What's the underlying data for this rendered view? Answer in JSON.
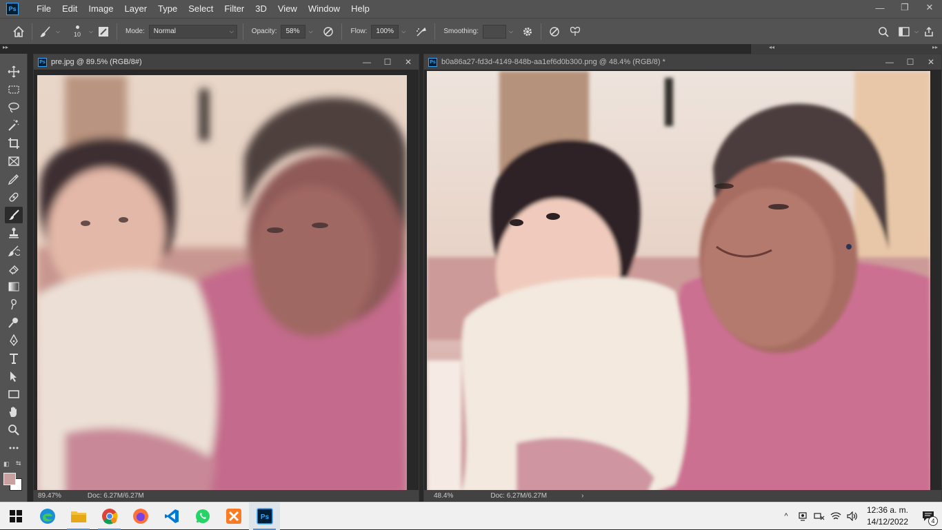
{
  "app": {
    "logo": "Ps"
  },
  "menu": [
    "File",
    "Edit",
    "Image",
    "Layer",
    "Type",
    "Select",
    "Filter",
    "3D",
    "View",
    "Window",
    "Help"
  ],
  "window_controls": {
    "minimize": "—",
    "restore": "❐",
    "close": "✕"
  },
  "options": {
    "brush_size": "10",
    "mode_label": "Mode:",
    "mode_value": "Normal",
    "opacity_label": "Opacity:",
    "opacity_value": "58%",
    "flow_label": "Flow:",
    "flow_value": "100%",
    "smoothing_label": "Smoothing:",
    "smoothing_value": ""
  },
  "documents": [
    {
      "title": "pre.jpg @ 89.5% (RGB/8#)",
      "status_zoom": "89.47%",
      "status_doc": "Doc: 6.27M/6.27M"
    },
    {
      "title": "b0a86a27-fd3d-4149-848b-aa1ef6d0b300.png @ 48.4% (RGB/8) *",
      "status_zoom": "48.4%",
      "status_doc": "Doc: 6.27M/6.27M"
    }
  ],
  "colors": {
    "foreground": "#c8a0a0",
    "background": "#ffffff",
    "ui_panel": "#535353",
    "accent": "#31a8ff"
  },
  "taskbar": {
    "apps": [
      "edge-icon",
      "file-explorer-icon",
      "chrome-icon",
      "firefox-icon",
      "vscode-icon",
      "whatsapp-icon",
      "xampp-icon",
      "photoshop-icon"
    ],
    "time": "12:36 a. m.",
    "date": "14/12/2022",
    "notification_count": "4"
  }
}
